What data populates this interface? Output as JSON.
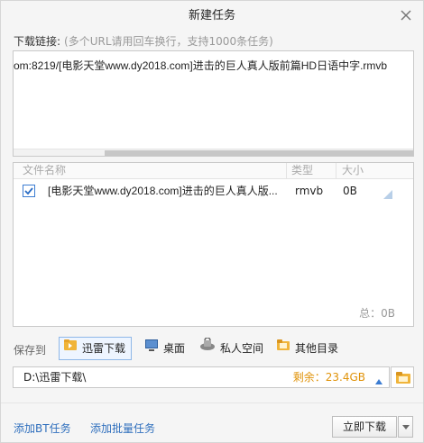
{
  "dialog": {
    "title": "新建任务",
    "close_icon": "close-icon"
  },
  "url_section": {
    "label": "下载链接:",
    "hint": "(多个URL请用回车换行，支持1000条任务)",
    "value": "om:8219/[电影天堂www.dy2018.com]进击的巨人真人版前篇HD日语中字.rmvb"
  },
  "file_table": {
    "headers": {
      "name": "文件名称",
      "type": "类型",
      "size": "大小"
    },
    "rows": [
      {
        "checked": true,
        "name": "[电影天堂www.dy2018.com]进击的巨人真人版...",
        "type": "rmvb",
        "size": "0B"
      }
    ],
    "total": "总：0B"
  },
  "save_to": {
    "label": "保存到",
    "locations": [
      {
        "label": "迅雷下载",
        "icon": "xunlei-download-folder-icon",
        "active": true
      },
      {
        "label": "桌面",
        "icon": "desktop-icon",
        "active": false
      },
      {
        "label": "私人空间",
        "icon": "private-space-icon",
        "active": false
      },
      {
        "label": "其他目录",
        "icon": "folder-icon",
        "active": false
      }
    ],
    "path": "D:\\迅雷下载\\",
    "free_space": "剩余：23.4GB"
  },
  "footer": {
    "add_bt_label": "添加BT任务",
    "add_batch_label": "添加批量任务",
    "download_now_label": "立即下载"
  },
  "colors": {
    "link": "#2f6fbd",
    "free_space": "#e0930a",
    "accent": "#3b7cd2"
  }
}
